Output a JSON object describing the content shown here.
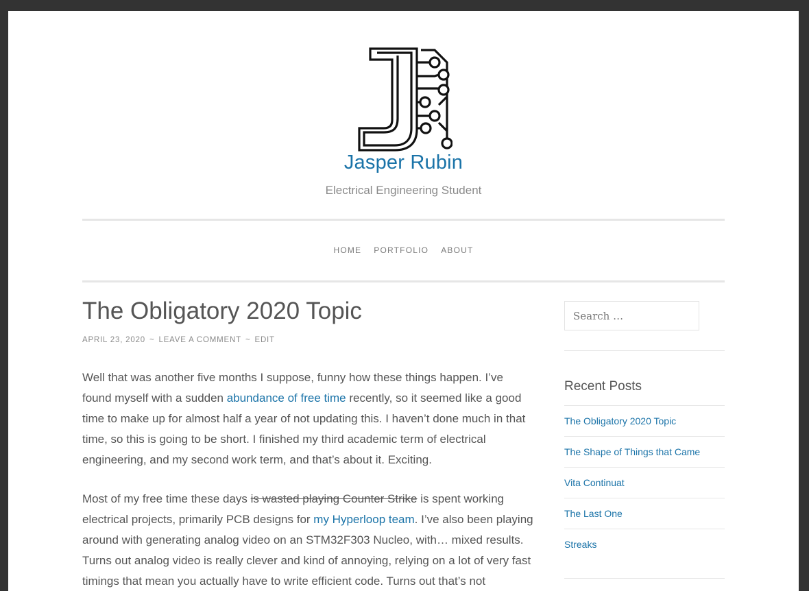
{
  "site": {
    "title": "Jasper Rubin",
    "tagline": "Electrical Engineering Student",
    "logo_icon": "circuit-j-logo"
  },
  "nav": {
    "items": [
      {
        "label": "HOME"
      },
      {
        "label": "PORTFOLIO"
      },
      {
        "label": "ABOUT"
      }
    ]
  },
  "post": {
    "title": "The Obligatory 2020 Topic",
    "meta": {
      "date": "APRIL 23, 2020",
      "sep": "~",
      "comment": "LEAVE A COMMENT",
      "edit": "EDIT"
    },
    "p1": {
      "t1": "Well that was another five months I suppose, funny how these things happen. I’ve found myself with a sudden ",
      "link": "abundance of free time",
      "t2": " recently, so it seemed like a good time to make up for almost half a year of not updating this. I haven’t done much in that time, so this is going to be short. I finished my third academic term of electrical engineering, and my second work term, and that’s about it. Exciting."
    },
    "p2": {
      "t1": "Most of my free time these days ",
      "strike": "is wasted playing Counter Strike",
      "t2": " is spent working electrical projects, primarily PCB designs for ",
      "link": "my Hyperloop team",
      "t3": ". I’ve also been playing around with generating analog video on an STM32F303 Nucleo, with… mixed results. Turns out analog video is really clever and kind of annoying, relying on a lot of very fast timings that mean you actually have to write efficient code. Turns out that’s not"
    }
  },
  "sidebar": {
    "search_placeholder": "Search …",
    "recent_title": "Recent Posts",
    "recent": [
      {
        "label": "The Obligatory 2020 Topic"
      },
      {
        "label": "The Shape of Things that Came"
      },
      {
        "label": "Vita Continuat"
      },
      {
        "label": "The Last One"
      },
      {
        "label": "Streaks"
      }
    ]
  },
  "colors": {
    "link": "#1a73a8",
    "text": "#555555",
    "frame": "#333333"
  }
}
